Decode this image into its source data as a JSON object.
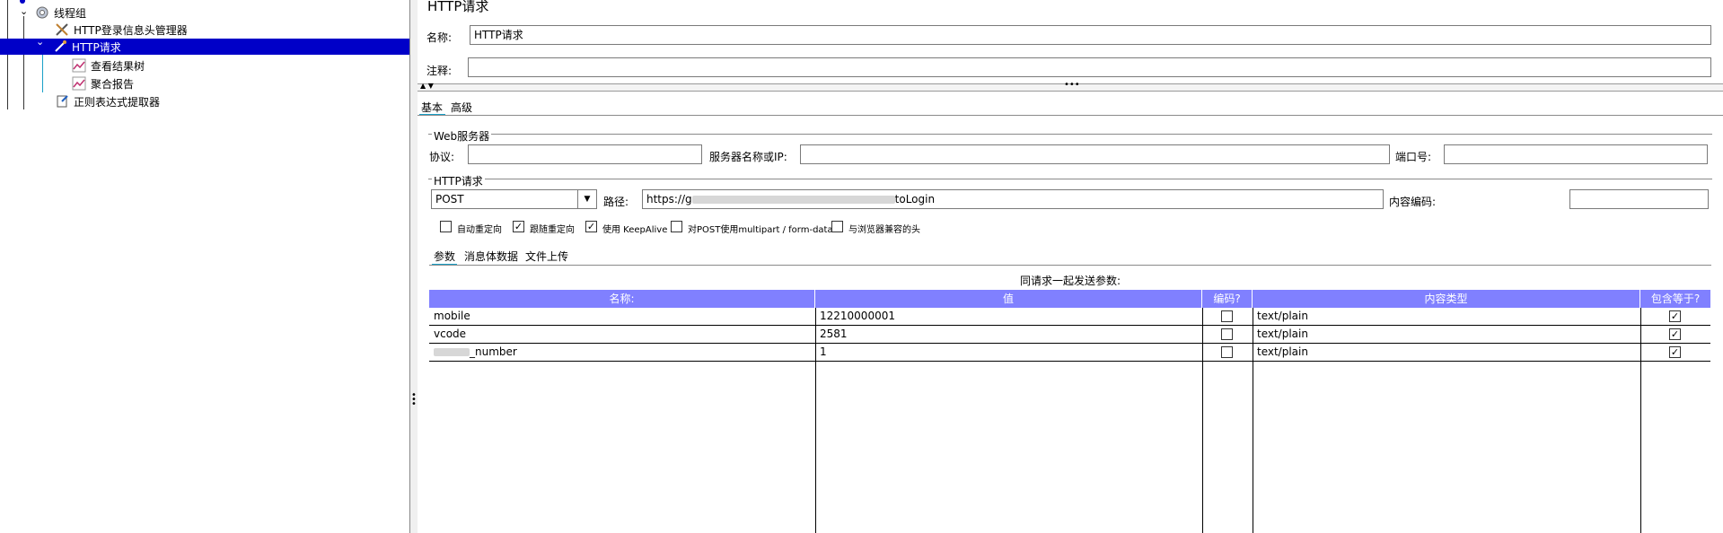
{
  "tree": {
    "items": [
      {
        "label": "线程组",
        "icon": "gear-icon"
      },
      {
        "label": "HTTP登录信息头管理器",
        "icon": "tools-icon"
      },
      {
        "label": "HTTP请求",
        "icon": "pipette-icon"
      },
      {
        "label": "查看结果树",
        "icon": "chart-icon"
      },
      {
        "label": "聚合报告",
        "icon": "chart-icon"
      },
      {
        "label": "正则表达式提取器",
        "icon": "document-icon"
      }
    ]
  },
  "panel": {
    "title": "HTTP请求",
    "name_label": "名称:",
    "name_value": "HTTP请求",
    "comment_label": "注释:",
    "comment_value": ""
  },
  "tabs": [
    "基本",
    "高级"
  ],
  "web_server": {
    "section_title": "Web服务器",
    "protocol_label": "协议:",
    "protocol_value": "",
    "server_label": "服务器名称或IP:",
    "server_value": "",
    "port_label": "端口号:",
    "port_value": ""
  },
  "http_request": {
    "section_title": "HTTP请求",
    "method": "POST",
    "path_label": "路径:",
    "path_prefix": "https://g",
    "path_suffix": "toLogin",
    "encoding_label": "内容编码:",
    "encoding_value": ""
  },
  "options": [
    {
      "label": "自动重定向",
      "checked": false
    },
    {
      "label": "跟随重定向",
      "checked": true
    },
    {
      "label": "使用 KeepAlive",
      "checked": true
    },
    {
      "label": "对POST使用multipart / form-data",
      "checked": false
    },
    {
      "label": "与浏览器兼容的头",
      "checked": false
    }
  ],
  "subtabs": [
    "参数",
    "消息体数据",
    "文件上传"
  ],
  "params": {
    "caption": "同请求一起发送参数:",
    "headers": [
      "名称:",
      "值",
      "编码?",
      "内容类型",
      "包含等于?"
    ],
    "rows": [
      {
        "name": "mobile",
        "value": "12210000001",
        "encode": false,
        "content_type": "text/plain",
        "include_equals": true
      },
      {
        "name": "vcode",
        "value": "2581",
        "encode": false,
        "content_type": "text/plain",
        "include_equals": true
      },
      {
        "name": "_number",
        "value": "1",
        "encode": false,
        "content_type": "text/plain",
        "include_equals": true
      }
    ]
  },
  "colors": {
    "selection": "#0000c8",
    "table_header": "#8080ff",
    "tab_accent": "#19a0c8"
  }
}
